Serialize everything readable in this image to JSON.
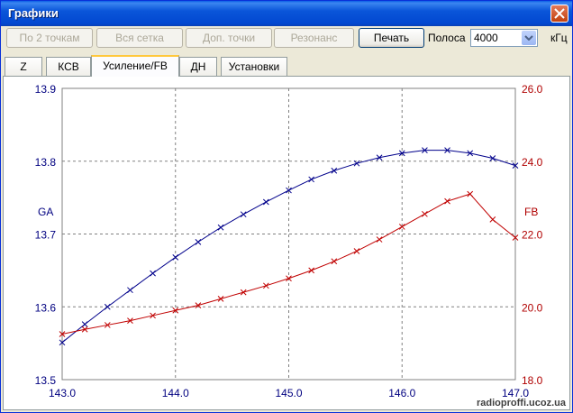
{
  "window": {
    "title": "Графики"
  },
  "toolbar": {
    "buttons": [
      {
        "label": "По 2 точкам",
        "enabled": false
      },
      {
        "label": "Вся сетка",
        "enabled": false
      },
      {
        "label": "Доп. точки",
        "enabled": false
      },
      {
        "label": "Резонанс",
        "enabled": false
      },
      {
        "label": "Печать",
        "enabled": true
      }
    ],
    "band_label": "Полоса",
    "band_value": "4000",
    "band_unit": "кГц"
  },
  "tabs": [
    {
      "label": "Z",
      "selected": false
    },
    {
      "label": "КСВ",
      "selected": false
    },
    {
      "label": "Усиление/FB",
      "selected": true
    },
    {
      "label": "ДН",
      "selected": false
    },
    {
      "label": "Установки",
      "selected": false
    }
  ],
  "watermark": "radioproffi.ucoz.ua",
  "chart_data": {
    "type": "line",
    "x": [
      143.0,
      143.2,
      143.4,
      143.6,
      143.8,
      144.0,
      144.2,
      144.4,
      144.6,
      144.8,
      145.0,
      145.2,
      145.4,
      145.6,
      145.8,
      146.0,
      146.2,
      146.4,
      146.6,
      146.8,
      147.0
    ],
    "xticks": [
      "143.0",
      "144.0",
      "145.0",
      "146.0",
      "147.0"
    ],
    "xlim": [
      143.0,
      147.0
    ],
    "ylabel_left": "GA",
    "ylabel_right": "FB",
    "ylim_left": [
      13.5,
      13.9
    ],
    "ylim_right": [
      18.0,
      26.0
    ],
    "yticks_left": [
      "13.5",
      "13.6",
      "13.7",
      "13.8",
      "13.9"
    ],
    "yticks_right": [
      "18.0",
      "20.0",
      "22.0",
      "24.0",
      "26.0"
    ],
    "grid": true,
    "series": [
      {
        "name": "GA",
        "axis": "left",
        "color": "#00008b",
        "values": [
          13.551,
          13.576,
          13.6,
          13.623,
          13.646,
          13.668,
          13.689,
          13.709,
          13.727,
          13.744,
          13.76,
          13.775,
          13.787,
          13.797,
          13.805,
          13.811,
          13.815,
          13.815,
          13.811,
          13.804,
          13.794
        ]
      },
      {
        "name": "FB",
        "axis": "right",
        "color": "#c00000",
        "x": [
          143.0,
          143.2,
          143.4,
          143.6,
          143.8,
          144.0,
          144.2,
          144.4,
          144.6,
          144.8,
          145.0,
          145.2,
          145.4,
          145.6,
          145.8,
          146.0,
          146.2,
          146.4,
          146.6,
          146.8,
          147.0
        ],
        "values": [
          19.25,
          19.38,
          19.5,
          19.62,
          19.76,
          19.9,
          20.04,
          20.22,
          20.4,
          20.58,
          20.78,
          21.0,
          21.25,
          21.53,
          21.85,
          22.2,
          22.55,
          22.9,
          23.1,
          22.4,
          21.9
        ]
      }
    ]
  }
}
